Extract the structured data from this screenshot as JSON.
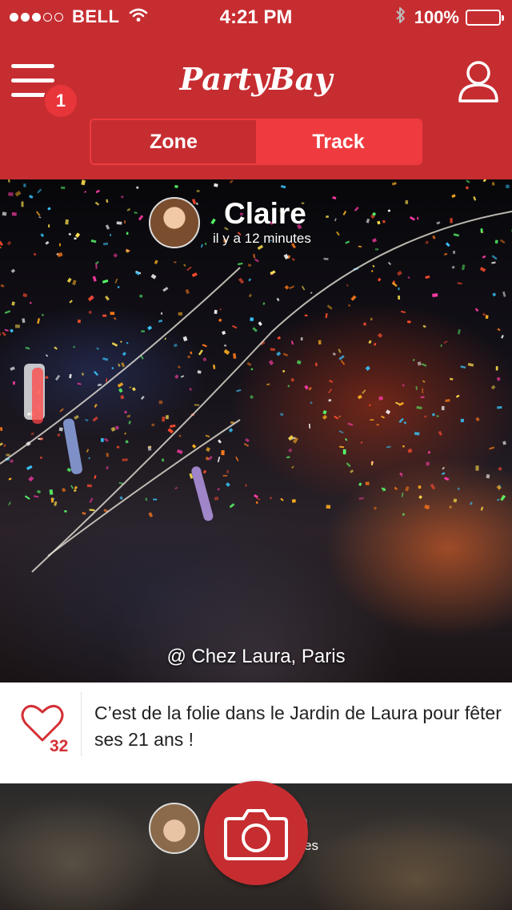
{
  "status_bar": {
    "carrier": "BELL",
    "time": "4:21 PM",
    "battery": "100%",
    "signal_bars": 3,
    "signal_max": 5
  },
  "header": {
    "app_title": "PartyBay",
    "notification_count": "1",
    "tabs": [
      {
        "label": "Zone",
        "active": false
      },
      {
        "label": "Track",
        "active": true
      }
    ]
  },
  "posts": [
    {
      "author": "Claire",
      "time_ago": "il y a 12 minutes",
      "location": "@ Chez Laura, Paris",
      "caption": "C’est de la folie dans le Jardin de Laura pour fêter ses 21 ans !",
      "likes": "32"
    },
    {
      "author_partial": "e",
      "time_partial": "es"
    }
  ],
  "icons": {
    "menu": "hamburger-icon",
    "profile": "user-icon",
    "like": "heart-icon",
    "camera": "camera-icon",
    "wifi": "wifi-icon",
    "bluetooth": "bluetooth-icon",
    "battery": "battery-icon"
  },
  "colors": {
    "header_bg": "#c62d31",
    "active_tab": "#ef3b3f",
    "badge": "#e8353a",
    "like_count": "#d33035"
  }
}
